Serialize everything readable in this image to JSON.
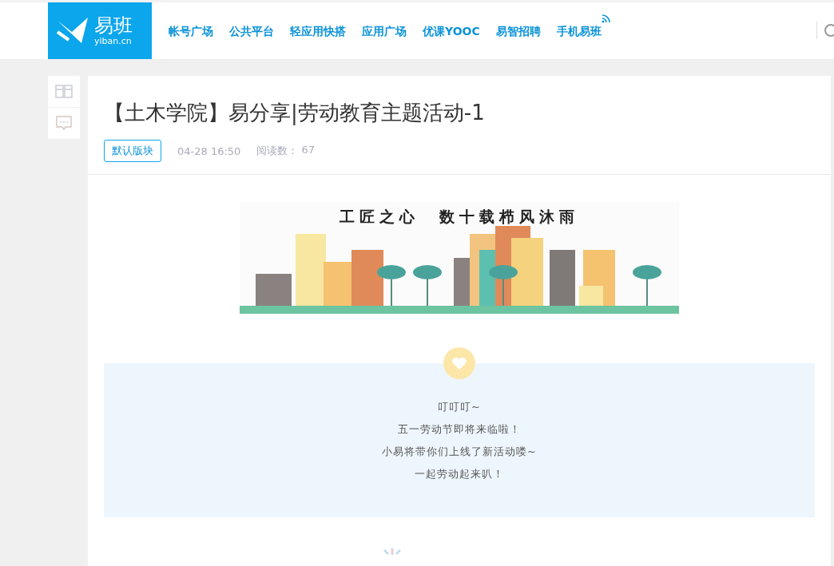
{
  "header": {
    "logo": {
      "name": "易班",
      "domain": "yiban.cn"
    },
    "nav": [
      {
        "label": "帐号广场"
      },
      {
        "label": "公共平台"
      },
      {
        "label": "轻应用快搭"
      },
      {
        "label": "应用广场"
      },
      {
        "label": "优课YOOC"
      },
      {
        "label": "易智招聘"
      },
      {
        "label": "手机易班"
      }
    ]
  },
  "article": {
    "title": "【土木学院】易分享|劳动教育主题活动-1",
    "category": "默认版块",
    "time": "04-28 16:50",
    "reads_label": "阅读数：",
    "reads": "67",
    "banner_text": "工匠之心　数十载栉风沐雨",
    "notice": [
      "叮叮叮~",
      "五一劳动节即将来临啦！",
      "小易将带你们上线了新活动喽~",
      "一起劳动起来叭！"
    ]
  }
}
